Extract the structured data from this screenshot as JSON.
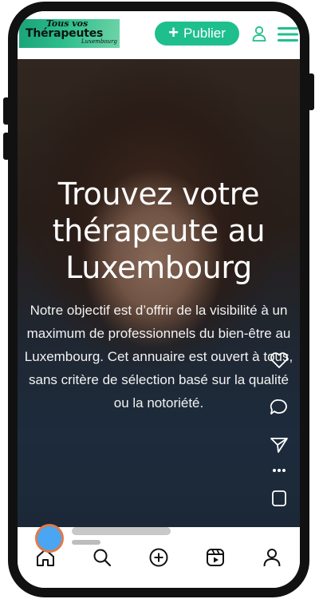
{
  "header": {
    "logo_top": "Tous vos",
    "logo_main": "Thérapeutes",
    "logo_sub": "Luxembourg",
    "publish_label": "Publier",
    "accent": "#1fbf8d"
  },
  "hero": {
    "title": "Trouvez votre thérapeute au Luxembourg",
    "text": "Notre objectif est d’offrir de la visibilité à un maximum de professionnels du bien-être au Luxembourg. Cet annuaire est ouvert à tous, sans critère de sélection basé sur la qualité ou la notoriété."
  },
  "side_actions": [
    "heart-icon",
    "comment-icon",
    "send-icon",
    "more-icon",
    "bookmark-icon"
  ],
  "bottom_nav": [
    "home-icon",
    "search-icon",
    "add-icon",
    "reels-icon",
    "profile-icon"
  ]
}
